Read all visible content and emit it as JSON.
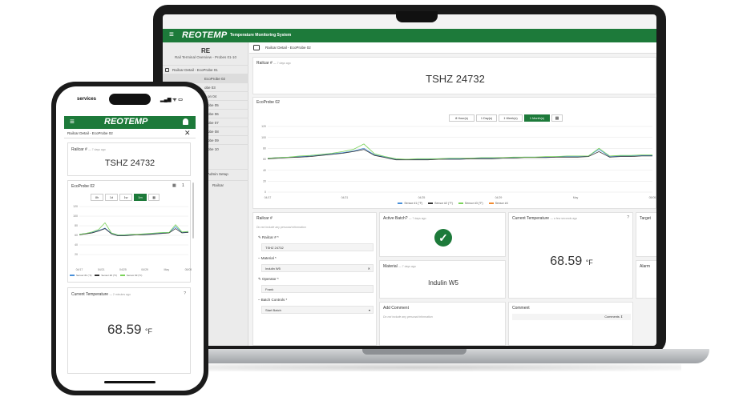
{
  "brand": {
    "logo": "REOTEMP",
    "subtitle": "Temperature Monitoring System",
    "accent": "#1d7a3a"
  },
  "laptop": {
    "sidebar": {
      "logo": "RE",
      "title": "Rail Terminal Overview - Probes 01-10",
      "items": [
        {
          "label": "Railcar Detail - EcoProbe 01"
        },
        {
          "label": "EcoProbe 02"
        },
        {
          "label": "obe 03"
        },
        {
          "label": "on 04"
        },
        {
          "label": "obe 05"
        },
        {
          "label": "obe 06"
        },
        {
          "label": "obe 07"
        },
        {
          "label": "obe 08"
        },
        {
          "label": "obe 09"
        },
        {
          "label": "obe 10"
        },
        {
          "label": "Admin Setup"
        },
        {
          "label": "Railcar"
        }
      ]
    },
    "breadcrumb": "Railcar Detail - EcoProbe 02",
    "railcar_card": {
      "title": "Railcar #",
      "time": "— 7 days ago",
      "value": "TSHZ 24732"
    },
    "chart_card": {
      "title": "EcoProbe 02",
      "ranges": [
        "8 Hour(s)",
        "1 Day(s)",
        "1 Week(s)",
        "1 Month(s)"
      ],
      "active_range": "1 Month(s)",
      "calendar_icon": "calendar-icon"
    },
    "form": {
      "title": "Railcar #",
      "hint": "Do not include any personal information",
      "railcar_label": "Railcar # *",
      "railcar_value": "TSHZ 24732",
      "material_label": "Material *",
      "material_value": "Indulin W5",
      "operator_label": "Operator *",
      "operator_value": "Frank",
      "batch_label": "Batch Controls *",
      "batch_value": "Start Batch"
    },
    "active_batch": {
      "title": "Active Batch?",
      "time": "— 7 days ago"
    },
    "material_card": {
      "title": "Material",
      "time": "— 7 days ago",
      "value": "Indulin W5"
    },
    "add_comment": {
      "title": "Add Comment",
      "hint": "Do not include any personal information"
    },
    "current_temp": {
      "title": "Current Temperature",
      "time": "— a few seconds ago",
      "value": "68.59",
      "unit": "°F"
    },
    "comment": {
      "title": "Comment",
      "column": "Comments ⇕"
    },
    "target": {
      "title": "Target"
    },
    "alarm": {
      "title": "Alarm"
    }
  },
  "phone": {
    "carrier": "services",
    "status": "▂▄▆ ᯤ ▭",
    "breadcrumb": "Railcar Detail - EcoProbe 02",
    "railcar_card": {
      "title": "Railcar #",
      "time": "— 7 days ago",
      "value": "TSHZ 24732"
    },
    "chart_card": {
      "title": "EcoProbe 02",
      "page": "1",
      "ranges": [
        "8h",
        "1d",
        "1w",
        "1m"
      ],
      "active_range": "1m"
    },
    "current_temp": {
      "title": "Current Temperature",
      "time": "— 2 minutes ago",
      "value": "68.59",
      "unit": "°F"
    }
  },
  "chart_data": {
    "type": "line",
    "x": [
      "04/17",
      "04/21",
      "04/25",
      "04/29",
      "May",
      "05/05"
    ],
    "ylim": [
      0,
      120
    ],
    "yticks": [
      0,
      20,
      40,
      60,
      80,
      100,
      120
    ],
    "legend": [
      "Sensor #1 (°F)",
      "Sensor #2 (°F)",
      "Sensor #3 (°F)",
      "Sensor #4"
    ],
    "series": [
      {
        "name": "Sensor #1 (°F)",
        "color": "#4a90d9",
        "values": [
          62,
          63,
          64,
          65,
          66,
          68,
          70,
          72,
          75,
          80,
          68,
          64,
          60,
          60,
          60,
          60,
          61,
          61,
          61,
          62,
          62,
          62,
          63,
          63,
          64,
          64,
          64,
          65,
          65,
          65,
          66,
          78,
          65,
          66,
          66,
          67,
          67
        ]
      },
      {
        "name": "Sensor #2 (°F)",
        "color": "#333333",
        "values": [
          61,
          62,
          63,
          64,
          65,
          67,
          69,
          71,
          74,
          78,
          67,
          63,
          59,
          59,
          59,
          59,
          60,
          60,
          60,
          61,
          61,
          61,
          62,
          62,
          63,
          63,
          63,
          64,
          64,
          64,
          65,
          74,
          64,
          65,
          65,
          66,
          66
        ]
      },
      {
        "name": "Sensor #3 (°F)",
        "color": "#7bd35a",
        "values": [
          62,
          63,
          64,
          66,
          67,
          69,
          71,
          74,
          78,
          88,
          70,
          65,
          61,
          60,
          61,
          61,
          61,
          62,
          62,
          62,
          63,
          63,
          63,
          64,
          64,
          64,
          65,
          65,
          66,
          66,
          66,
          80,
          66,
          67,
          67,
          68,
          68
        ]
      }
    ]
  },
  "phone_chart_data": {
    "type": "line",
    "x": [
      "04/17",
      "04/21",
      "04/25",
      "04/29",
      "May",
      "05/05"
    ],
    "ylim": [
      0,
      120
    ],
    "yticks": [
      20,
      40,
      60,
      80,
      100,
      120
    ],
    "legend": [
      "Sensor #1 (°F)",
      "Sensor #2 (°F)",
      "Sensor #3 (°F)",
      "Sensor #4"
    ],
    "series": [
      {
        "name": "Sensor #1 (°F)",
        "color": "#4a90d9",
        "values": [
          62,
          64,
          66,
          70,
          75,
          64,
          60,
          60,
          61,
          62,
          62,
          63,
          64,
          65,
          66,
          78,
          66,
          67
        ]
      },
      {
        "name": "Sensor #2 (°F)",
        "color": "#333333",
        "values": [
          61,
          63,
          65,
          69,
          74,
          63,
          59,
          59,
          60,
          61,
          61,
          62,
          63,
          64,
          65,
          74,
          65,
          66
        ]
      },
      {
        "name": "Sensor #3 (°F)",
        "color": "#7bd35a",
        "values": [
          62,
          64,
          67,
          72,
          86,
          65,
          61,
          61,
          62,
          62,
          63,
          64,
          65,
          66,
          66,
          82,
          67,
          68
        ]
      }
    ]
  }
}
